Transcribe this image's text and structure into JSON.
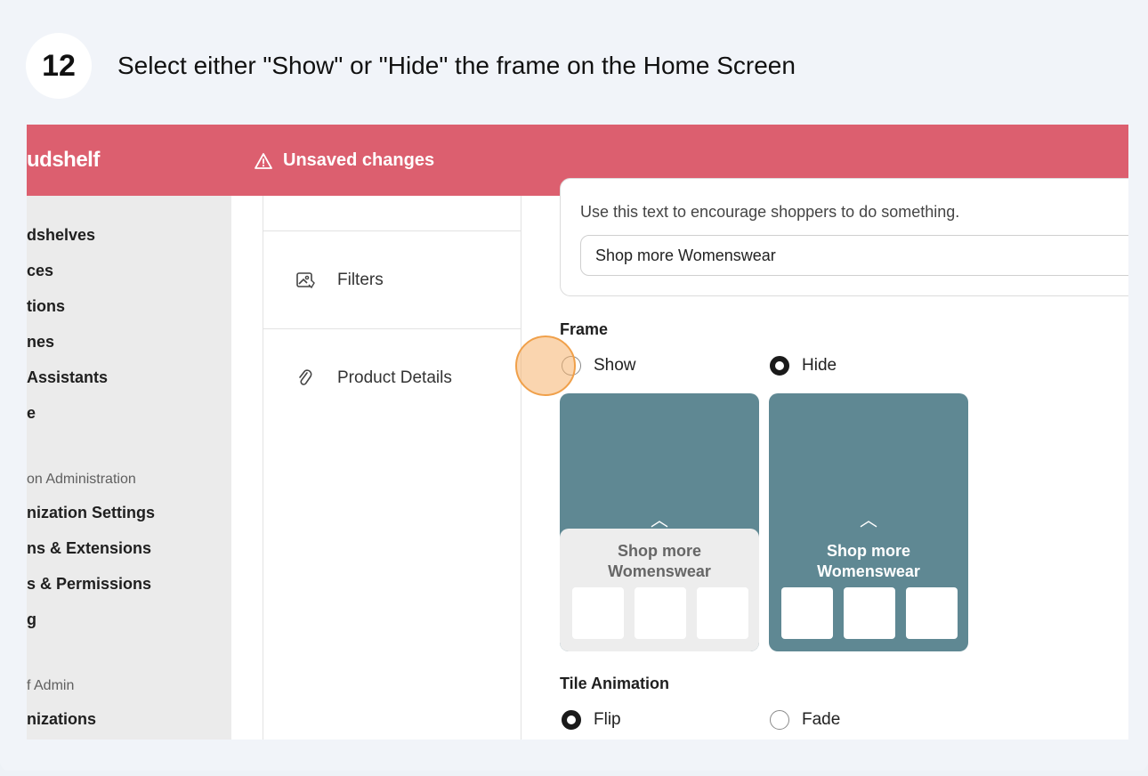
{
  "step": {
    "number": "12",
    "instruction": "Select either \"Show\" or \"Hide\" the frame on the Home Screen"
  },
  "app": {
    "brand": "udshelf",
    "unsaved_label": "Unsaved changes"
  },
  "sidebar": {
    "items": [
      {
        "label": "dshelves"
      },
      {
        "label": "ces"
      },
      {
        "label": "tions"
      },
      {
        "label": "nes"
      },
      {
        "label": "Assistants"
      },
      {
        "label": "e"
      }
    ],
    "section_admin": "on Administration",
    "admin_items": [
      {
        "label": "nization Settings"
      },
      {
        "label": "ns & Extensions"
      },
      {
        "label": "s & Permissions"
      },
      {
        "label": "g"
      }
    ],
    "section_super": "f Admin",
    "super_items": [
      {
        "label": "nizations"
      }
    ]
  },
  "settings_nav": {
    "items": [
      {
        "label": "Filters",
        "icon": "image-icon"
      },
      {
        "label": "Product Details",
        "icon": "link-icon"
      }
    ]
  },
  "call_to_action": {
    "helper": "Use this text to encourage shoppers to do something.",
    "value": "Shop more Womenswear"
  },
  "frame": {
    "label": "Frame",
    "options": [
      {
        "label": "Show",
        "checked": false
      },
      {
        "label": "Hide",
        "checked": true
      }
    ],
    "preview_text": "Shop more Womenswear",
    "preview_line1": "Shop more",
    "preview_line2": "Womenswear"
  },
  "tile_animation": {
    "label": "Tile Animation",
    "options": [
      {
        "label": "Flip",
        "checked": true
      },
      {
        "label": "Fade",
        "checked": false
      }
    ]
  },
  "colors": {
    "topbar": "#dc5f6f",
    "tile": "#5f8893",
    "highlight": "#f0a04a"
  }
}
